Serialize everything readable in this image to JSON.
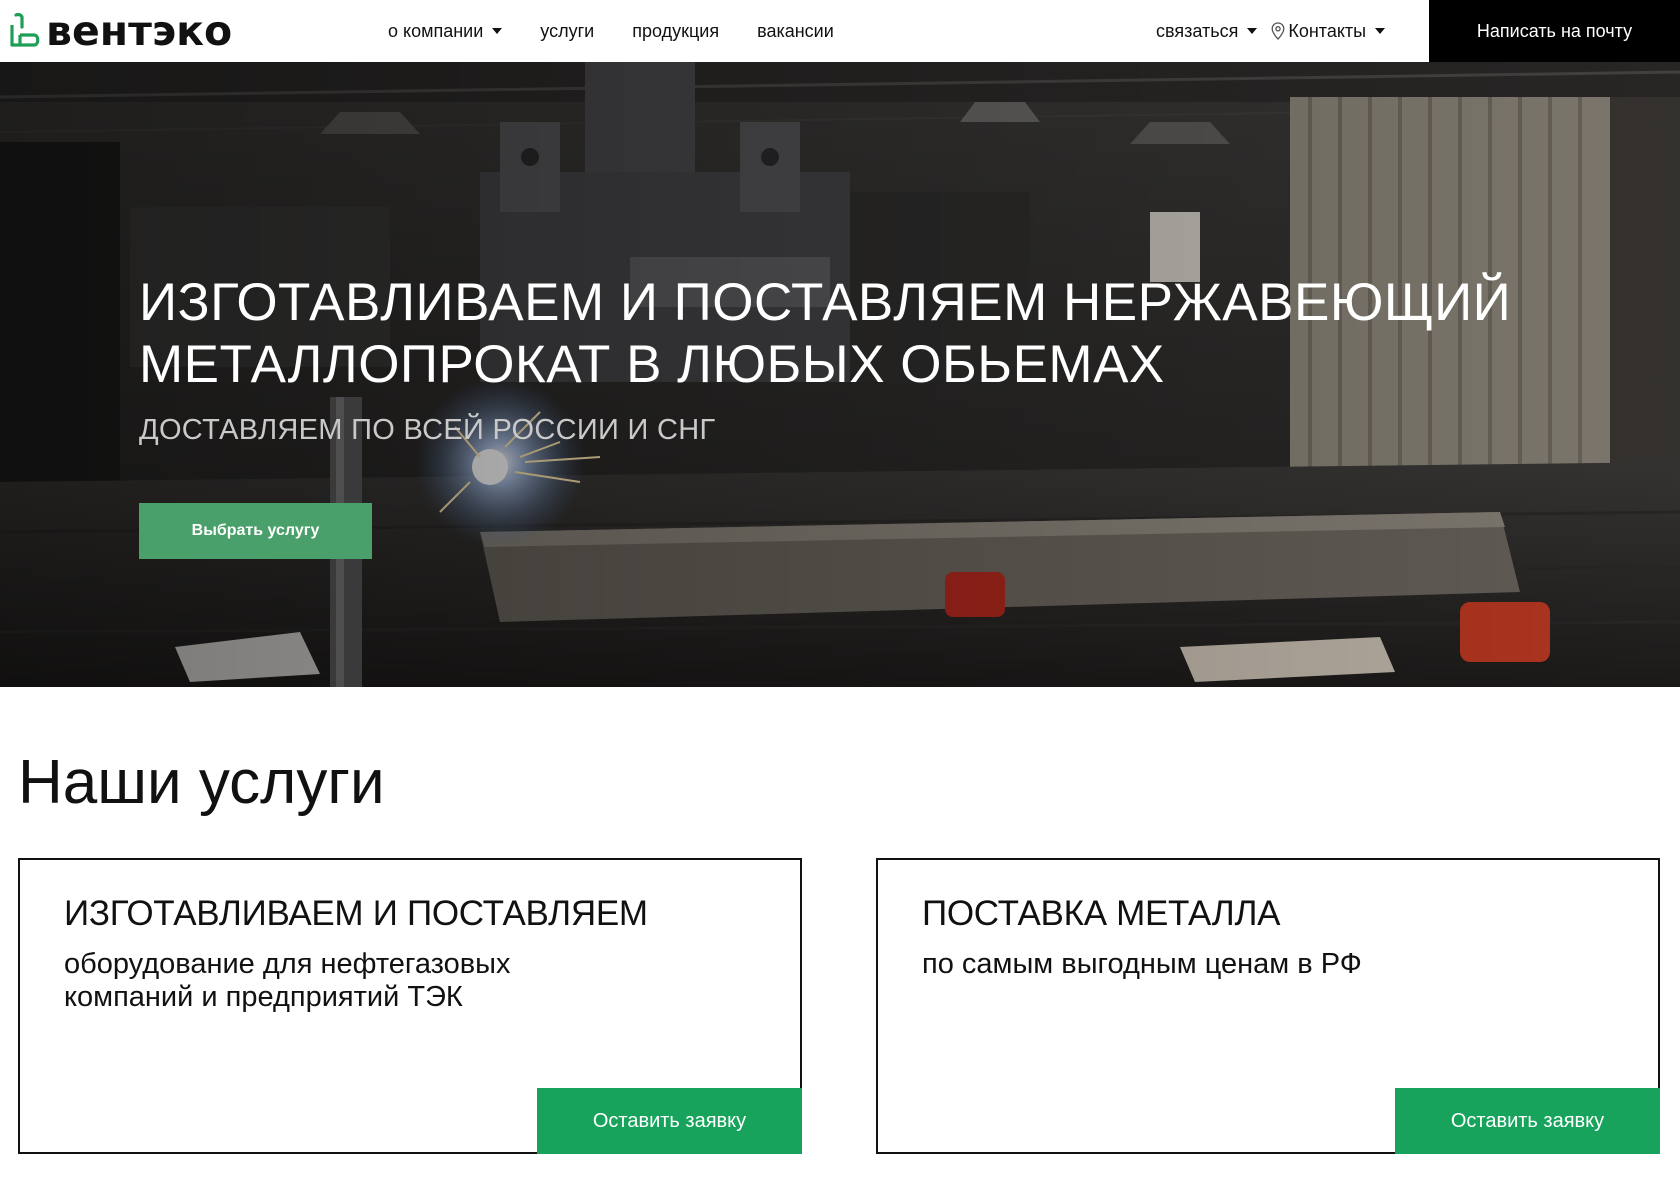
{
  "header": {
    "logo_text": "вентэко",
    "nav": [
      {
        "label": "о компании",
        "has_dropdown": true
      },
      {
        "label": "услуги",
        "has_dropdown": false
      },
      {
        "label": "продукция",
        "has_dropdown": false
      },
      {
        "label": "вакансии",
        "has_dropdown": false
      }
    ],
    "contact_label": "связаться",
    "contacts_label": "Контакты",
    "mail_button": "Написать на почту"
  },
  "hero": {
    "title_line1": "ИЗГОТАВЛИВАЕМ И ПОСТАВЛЯЕМ НЕРЖАВЕЮЩИЙ",
    "title_line2": "МЕТАЛЛОПРОКАТ В ЛЮБЫХ ОБЬЕМАХ",
    "subtitle": "ДОСТАВЛЯЕМ ПО ВСЕЙ РОССИИ И СНГ",
    "button": "Выбрать услугу"
  },
  "services": {
    "title": "Наши услуги",
    "cards": [
      {
        "title": "ИЗГОТАВЛИВАЕМ И ПОСТАВЛЯЕМ",
        "text_line1": "оборудование для нефтегазовых",
        "text_line2": "компаний и предприятий ТЭК",
        "button": "Оставить заявку"
      },
      {
        "title": "ПОСТАВКА МЕТАЛЛА",
        "text_line1": "по самым выгодным ценам в РФ",
        "text_line2": "",
        "button": "Оставить заявку"
      }
    ]
  },
  "colors": {
    "accent_green": "#17a35b",
    "hero_button_green": "#4aa06a",
    "logo_green": "#1e9e57",
    "header_button_bg": "#000000"
  },
  "icons": {
    "logo": "ventako-logo-icon",
    "caret": "caret-down-icon",
    "location": "location-pin-icon"
  }
}
